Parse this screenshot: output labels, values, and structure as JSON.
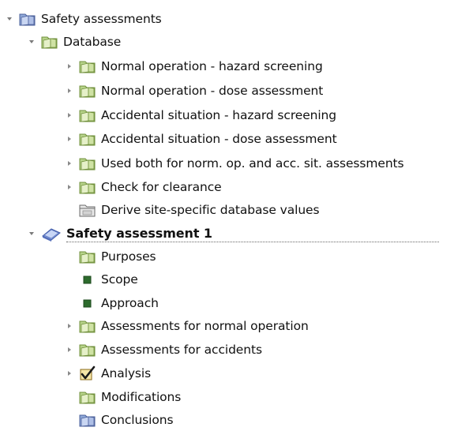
{
  "tree": {
    "root": {
      "label": "Safety assessments",
      "icon": "folder-blue-icon"
    },
    "database": {
      "label": "Database",
      "icon": "folder-green-icon",
      "items": [
        {
          "label": "Normal operation - hazard screening",
          "icon": "folder-green-icon"
        },
        {
          "label": "Normal operation - dose assessment",
          "icon": "folder-green-icon"
        },
        {
          "label": "Accidental situation - hazard screening",
          "icon": "folder-green-icon"
        },
        {
          "label": "Accidental situation - dose assessment",
          "icon": "folder-green-icon"
        },
        {
          "label": "Used both for norm. op. and acc. sit. assessments",
          "icon": "folder-green-icon"
        },
        {
          "label": "Check for clearance",
          "icon": "folder-green-icon"
        },
        {
          "label": "Derive site-specific database values",
          "icon": "folder-gray-icon"
        }
      ]
    },
    "assessment": {
      "label": "Safety assessment 1",
      "icon": "book-blue-icon",
      "items": [
        {
          "label": "Purposes",
          "icon": "folder-green-icon"
        },
        {
          "label": "Scope",
          "icon": "green-square-icon"
        },
        {
          "label": "Approach",
          "icon": "green-square-icon"
        },
        {
          "label": "Assessments for normal operation",
          "icon": "folder-green-icon"
        },
        {
          "label": "Assessments for accidents",
          "icon": "folder-green-icon"
        },
        {
          "label": "Analysis",
          "icon": "checkbox-checked-icon"
        },
        {
          "label": "Modifications",
          "icon": "folder-green-icon"
        },
        {
          "label": "Conclusions",
          "icon": "folder-blue-icon"
        }
      ]
    }
  }
}
